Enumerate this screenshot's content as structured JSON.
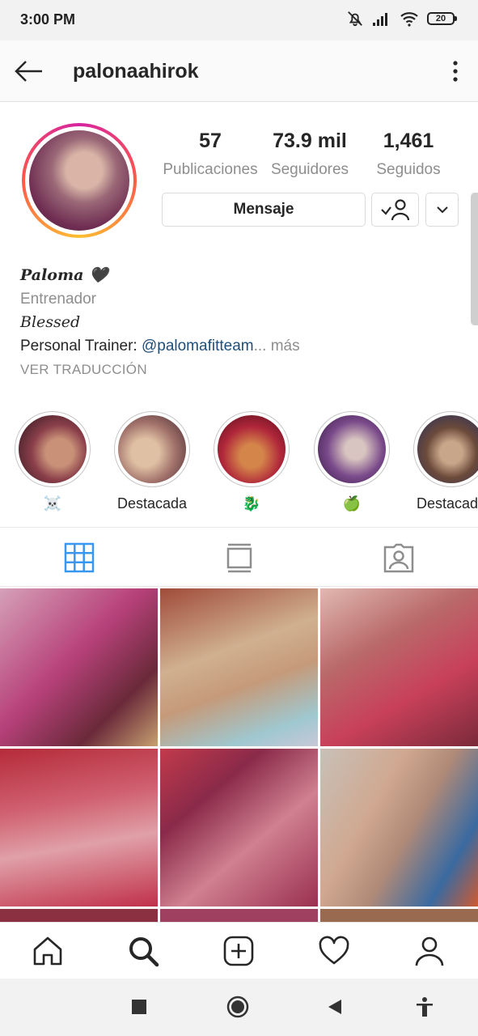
{
  "status_bar": {
    "time": "3:00 PM",
    "battery": "20",
    "icons": [
      "mute-icon",
      "signal-icon",
      "wifi-icon",
      "battery-icon"
    ]
  },
  "header": {
    "username": "palonaahirok",
    "icons": [
      "back-arrow-icon",
      "more-vertical-icon"
    ]
  },
  "profile": {
    "stats": [
      {
        "value": "57",
        "label": "Publicaciones"
      },
      {
        "value": "73.9 mil",
        "label": "Seguidores"
      },
      {
        "value": "1,461",
        "label": "Seguidos"
      }
    ],
    "message_button": "Mensaje",
    "name": "Paloma 🖤",
    "category": "Entrenador",
    "tagline": "Blessed",
    "bio_prefix": "Personal Trainer: ",
    "bio_mention": "@palomafitteam",
    "bio_more": "... más",
    "translate": "VER TRADUCCIÓN"
  },
  "highlights": [
    {
      "label": "☠️"
    },
    {
      "label": "Destacada"
    },
    {
      "label": "🐉"
    },
    {
      "label": "🍏"
    },
    {
      "label": "Destacada"
    }
  ],
  "tabs": [
    "grid-icon",
    "feed-icon",
    "tagged-icon"
  ],
  "bottom_nav": [
    "home-icon",
    "search-icon",
    "add-icon",
    "heart-icon",
    "profile-icon"
  ],
  "colors": {
    "accent_blue": "#3897f0",
    "mention_blue": "#1f4e79",
    "muted_text": "#8e8e8e"
  }
}
